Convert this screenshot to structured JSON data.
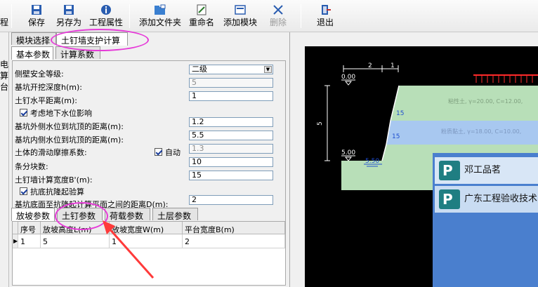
{
  "toolbar": {
    "partial_left": "程",
    "buttons": [
      {
        "label": "保存",
        "icon": "save-icon"
      },
      {
        "label": "另存为",
        "icon": "save-as-icon"
      },
      {
        "label": "工程属性",
        "icon": "project-properties-icon"
      },
      {
        "label": "添加文件夹",
        "icon": "add-folder-icon"
      },
      {
        "label": "重命名",
        "icon": "rename-icon"
      },
      {
        "label": "添加模块",
        "icon": "add-module-icon"
      },
      {
        "label": "删除",
        "icon": "delete-icon",
        "disabled": true
      },
      {
        "label": "退出",
        "icon": "exit-icon"
      }
    ]
  },
  "left_strip": [
    "电",
    "算",
    "台"
  ],
  "top_tabs": [
    "模块选择",
    "土钉墙支护计算"
  ],
  "sub_tabs": [
    "基本参数",
    "计算系数"
  ],
  "form": {
    "safety_grade_label": "侧壁安全等级:",
    "safety_grade_value": "二级",
    "depth_label": "基坑开挖深度h(m):",
    "depth_value": "5",
    "nail_spacing_label": "土钉水平距离(m):",
    "nail_spacing_value": "1",
    "groundwater_check": "考虑地下水位影响",
    "outer_water_label": "基坑外侧水位到坑顶的距离(m):",
    "outer_water_value": "1.2",
    "inner_water_label": "基坑内侧水位到坑顶的距离(m):",
    "inner_water_value": "5.5",
    "friction_label": "土体的滑动摩擦系数:",
    "friction_auto": "自动",
    "friction_value": "1.3",
    "strips_label": "条分块数:",
    "strips_value": "10",
    "wall_width_label": "土钉墙计算宽度B'(m):",
    "wall_width_value": "15",
    "heave_check": "抗底抗隆起验算",
    "heave_dist_label": "基坑底面至抗隆起计算平面之间的距离D(m):",
    "heave_dist_value": "2"
  },
  "bottom_tabs": [
    "放坡参数",
    "土钉参数",
    "荷载参数",
    "土层参数"
  ],
  "table": {
    "headers": [
      "序号",
      "放坡高度L(m)",
      "放坡宽度W(m)",
      "平台宽度B(m)"
    ],
    "rows": [
      [
        "1",
        "5",
        "1",
        "2"
      ]
    ]
  },
  "drawing": {
    "top_dims": [
      "2",
      "1"
    ],
    "elev_top": "0.00",
    "elev_bottom": "5.00",
    "height_dim": "5",
    "water_level": "5.50",
    "angles": [
      "15",
      "15"
    ],
    "soil_label_1": "粘性土, γ=20.00, C=12.00,",
    "soil_label_2": "粉质黏土, γ=18.00, C=10.00,"
  },
  "popup": {
    "items": [
      "邓工品茗",
      "广东工程验收技术"
    ]
  },
  "colors": {
    "annotation": "#e63bd8",
    "popup_bg": "#4a7fce",
    "soil_fill": "#b8dfb8",
    "water_fill": "#a8c8f0",
    "load_red": "#ff2a2a"
  }
}
